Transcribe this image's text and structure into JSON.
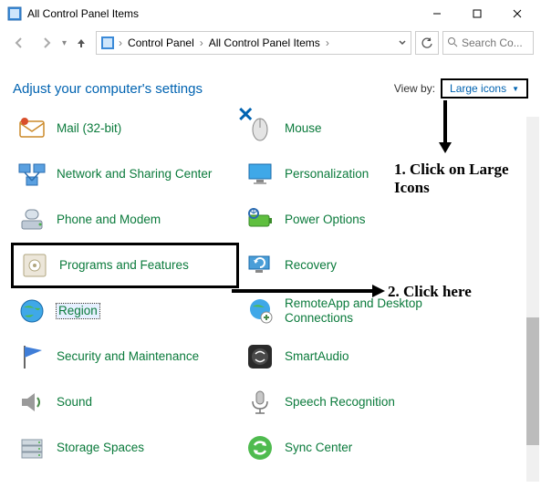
{
  "window": {
    "title": "All Control Panel Items"
  },
  "breadcrumb": {
    "root": "Control Panel",
    "current": "All Control Panel Items"
  },
  "search": {
    "placeholder": "Search Co..."
  },
  "header": {
    "adjust": "Adjust your computer's settings",
    "viewby_label": "View by:",
    "viewby_value": "Large icons"
  },
  "left_items": [
    {
      "label": "Mail (32-bit)"
    },
    {
      "label": "Network and Sharing Center"
    },
    {
      "label": "Phone and Modem"
    },
    {
      "label": "Programs and Features"
    },
    {
      "label": "Region"
    },
    {
      "label": "Security and Maintenance"
    },
    {
      "label": "Sound"
    },
    {
      "label": "Storage Spaces"
    }
  ],
  "right_items": [
    {
      "label": "Mouse"
    },
    {
      "label": "Personalization"
    },
    {
      "label": "Power Options"
    },
    {
      "label": "Recovery"
    },
    {
      "label": "RemoteApp and Desktop Connections"
    },
    {
      "label": "SmartAudio"
    },
    {
      "label": "Speech Recognition"
    },
    {
      "label": "Sync Center"
    }
  ],
  "annotations": {
    "step1": "1. Click on Large Icons",
    "step2": "2. Click here"
  }
}
